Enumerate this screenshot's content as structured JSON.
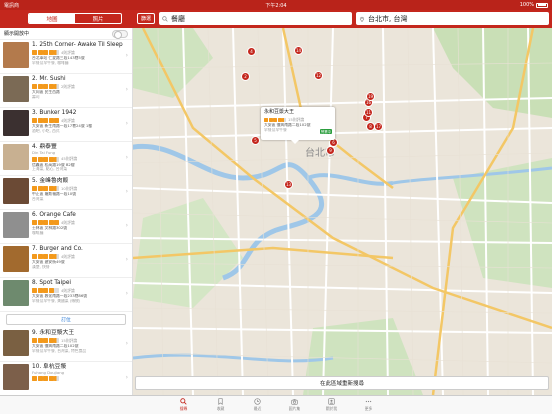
{
  "status": {
    "carrier": "電訊商",
    "time": "下午2:04",
    "battery": "100%"
  },
  "header": {
    "tabs": [
      {
        "label": "地圖",
        "active": true
      },
      {
        "label": "照片",
        "active": false
      }
    ],
    "search_button": "篩選",
    "query": "餐廳",
    "location": "台北市, 台灣"
  },
  "sidebar": {
    "heading": "顯示開放中",
    "ad_button": "訂位",
    "items": [
      {
        "title": "1. 25th Corner- Awake Til Sleep",
        "stars": 4.5,
        "reviews": "4則評論",
        "addr": "台北車站 仁愛路三段143巷5號",
        "meta": "早餐及早午餐, 咖啡廳",
        "thumb": "#b37a4c"
      },
      {
        "title": "2. Mr. Sushi",
        "stars": 4.5,
        "reviews": "2則評論",
        "addr": "大同區 民生西路",
        "meta": "壽司",
        "thumb": "#7b6a55"
      },
      {
        "title": "3. Bunker 1942",
        "stars": 5,
        "reviews": "4則評論",
        "addr": "大安區 新生南路一段17巷24號 1樓",
        "meta": "酒吧, 小吃, 西式",
        "thumb": "#3b3030"
      },
      {
        "title": "4. 鼎泰豐",
        "sub": "Din Tai Fung",
        "stars": 4.5,
        "reviews": "45則評論",
        "addr": "信義區 松高路19號 B2樓",
        "meta": "上海菜, 點心, 台灣菜",
        "thumb": "#c8b091"
      },
      {
        "title": "5. 金峰魯肉飯",
        "stars": 4.5,
        "reviews": "10則評論",
        "addr": "中正區 羅斯福路一段10號",
        "meta": "台灣菜",
        "thumb": "#6b4a35"
      },
      {
        "title": "6. Orange Cafe",
        "stars": 5,
        "reviews": "4則評論",
        "addr": "士林區 文林路302號",
        "meta": "咖啡廳",
        "thumb": "#8f8f8f"
      },
      {
        "title": "7. Burger and Co.",
        "stars": 4.5,
        "reviews": "4則評論",
        "addr": "大安區 建安街49號",
        "meta": "漢堡, 快餐",
        "thumb": "#a26a2e"
      },
      {
        "title": "8. Spot Taipei",
        "stars": 4,
        "reviews": "4則評論",
        "addr": "大安區 敦化南路一段233巷86號",
        "meta": "早餐及早午餐, 美國菜 (傳統)",
        "thumb": "#6e8a6e"
      },
      {
        "title": "9. 永和豆漿大王",
        "stars": 4.5,
        "reviews": "15則評論",
        "addr": "大安區 復興南路二段102號",
        "meta": "早餐及早午餐, 台灣菜, 特色食品",
        "thumb": "#7a6042"
      },
      {
        "title": "10. 阜杭豆漿",
        "sub": "Fuhang Doujiang",
        "stars": 4.5,
        "reviews": "",
        "addr": "",
        "meta": "",
        "thumb": "#7c5f4a"
      }
    ]
  },
  "callout": {
    "title": "永和豆漿大王",
    "stars": 4.5,
    "reviews": "15則評論",
    "addr": "大安區 復興南路二段102號",
    "meta": "早餐及早午餐",
    "badge": "營業中"
  },
  "map": {
    "district_label": "台北市",
    "redo_search": "在此區域重新搜尋",
    "markers": [
      "2",
      "4",
      "5",
      "6",
      "7",
      "8",
      "9",
      "11",
      "12",
      "13",
      "14",
      "16",
      "17",
      "19"
    ]
  },
  "tabbar": {
    "items": [
      {
        "label": "搜尋",
        "active": true
      },
      {
        "label": "收藏",
        "active": false
      },
      {
        "label": "最近",
        "active": false
      },
      {
        "label": "圖片集",
        "active": false
      },
      {
        "label": "關於我",
        "active": false
      },
      {
        "label": "更多",
        "active": false
      }
    ]
  },
  "colors": {
    "brand": "#c4271d",
    "star": "#f3991b",
    "open": "#2a9d3d"
  }
}
